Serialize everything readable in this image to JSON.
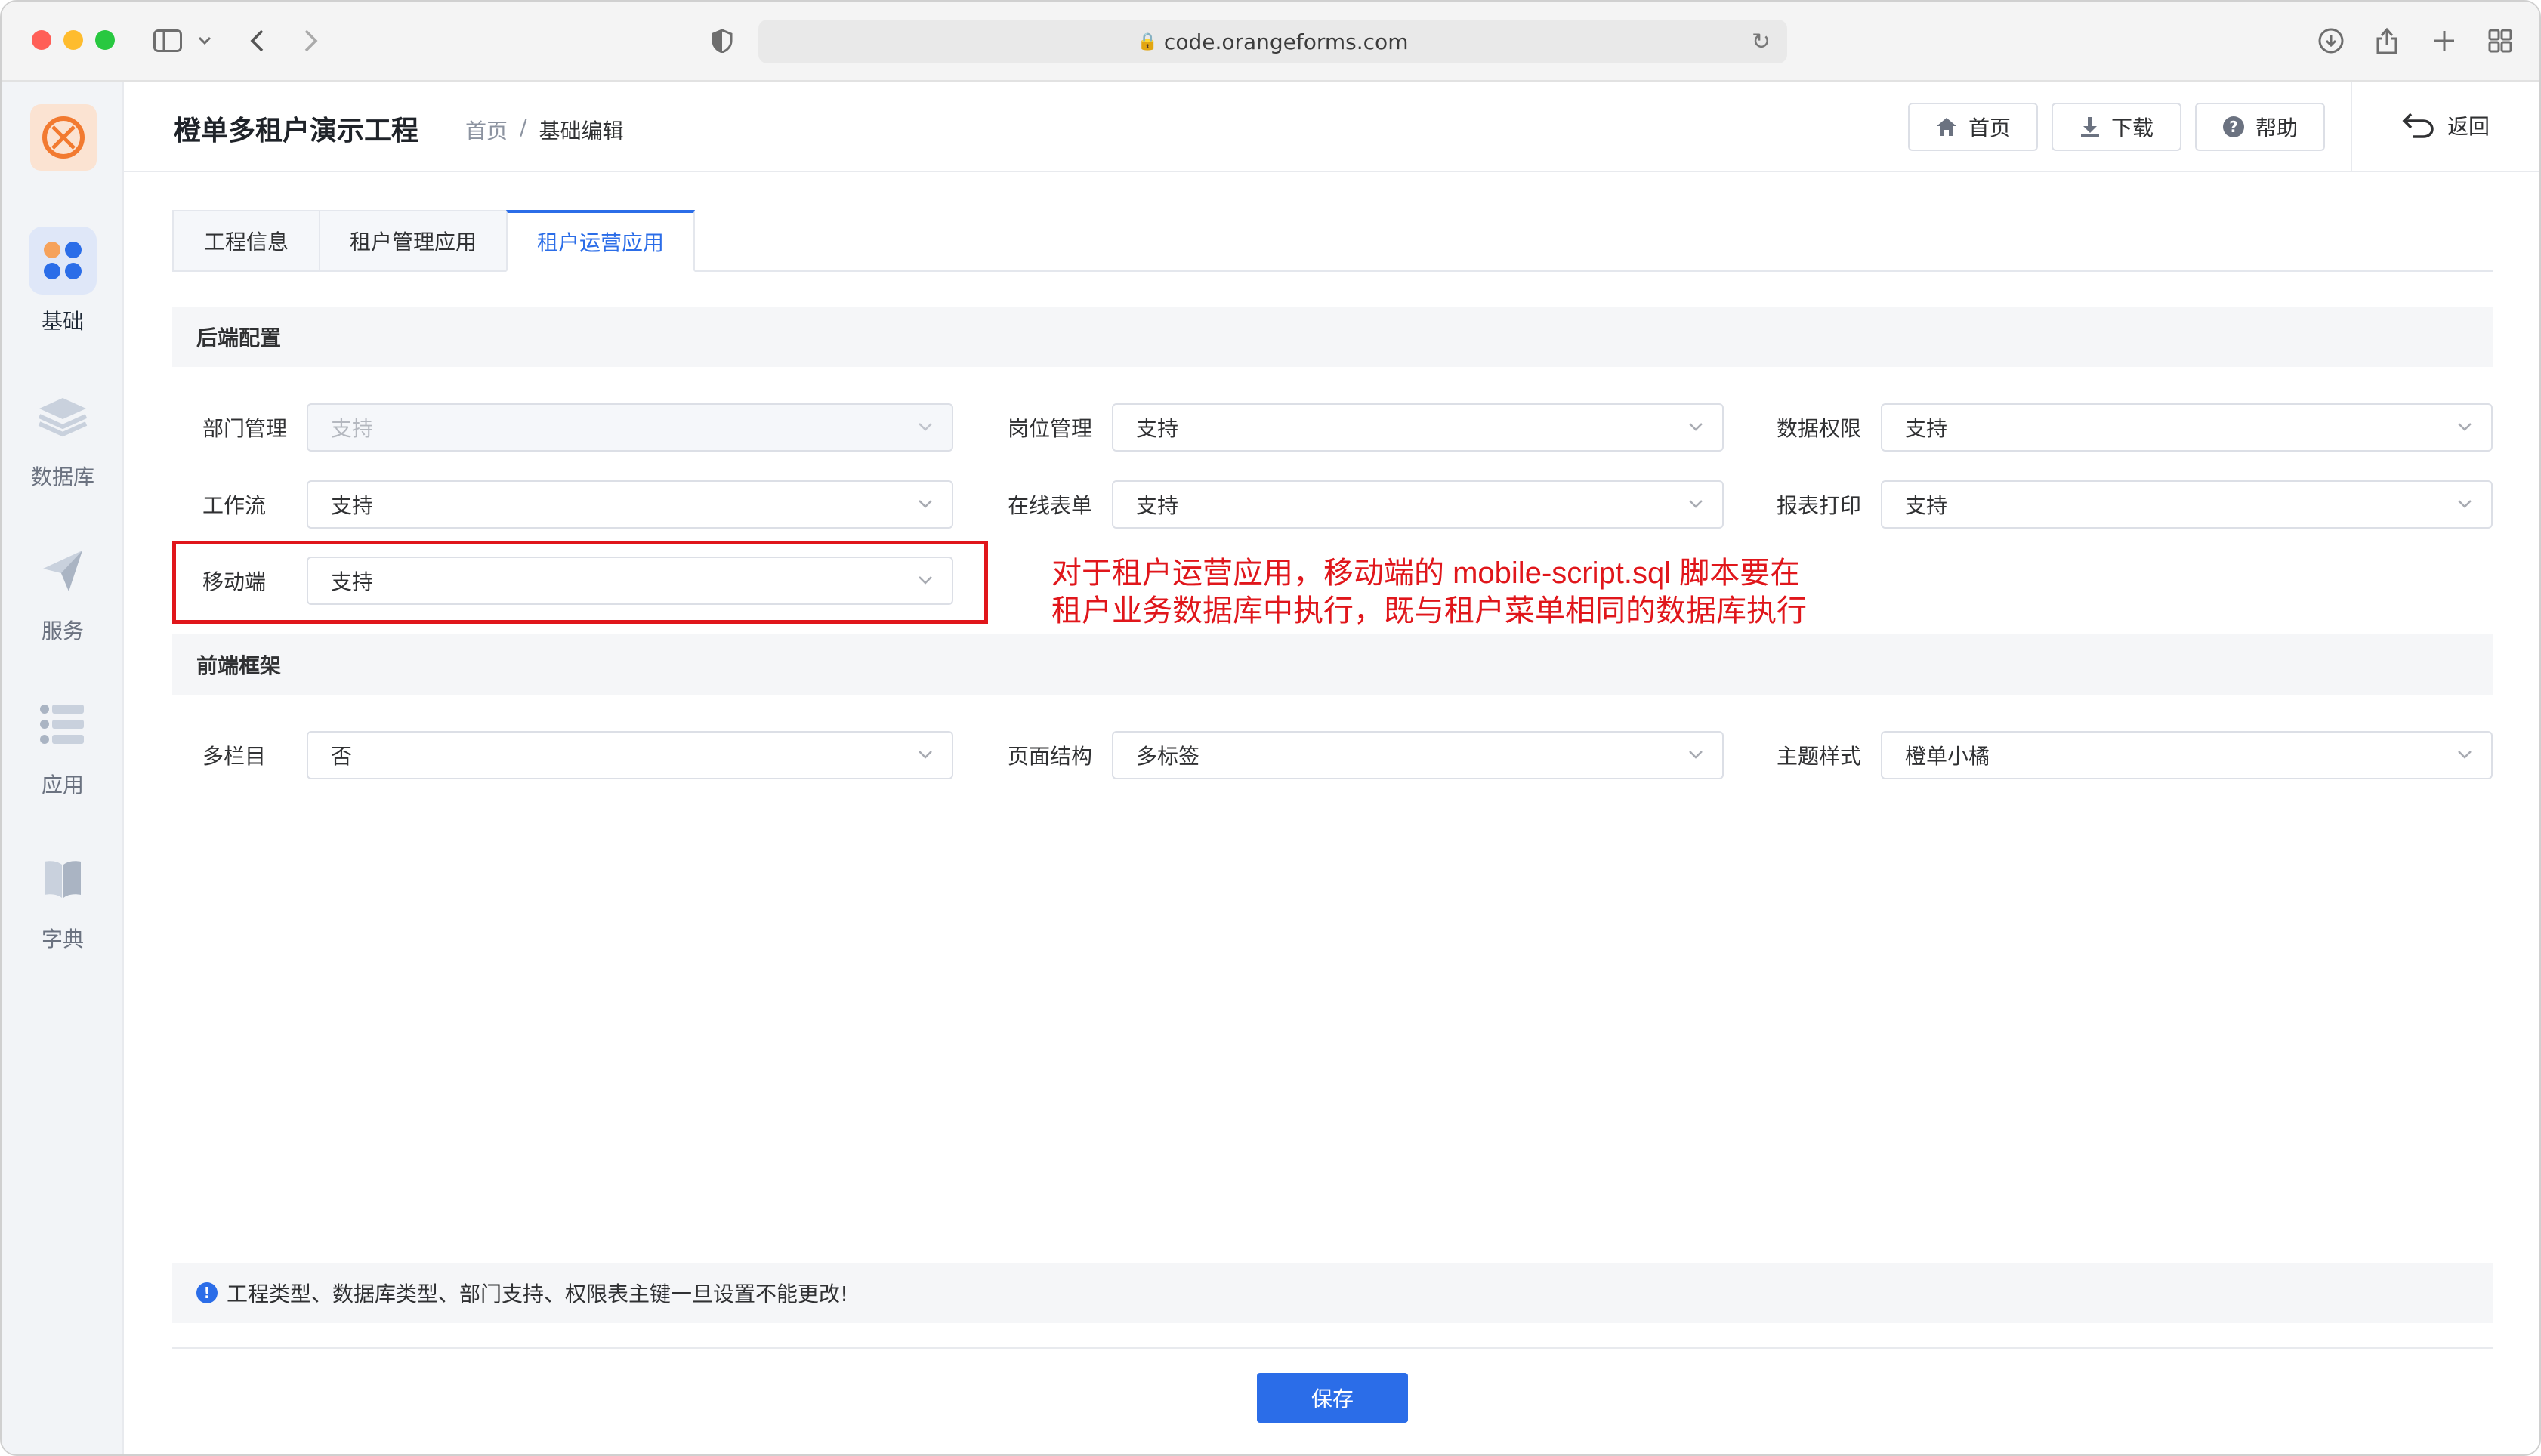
{
  "browser": {
    "url": "code.orangeforms.com"
  },
  "sidebar": {
    "items": [
      {
        "label": "基础",
        "icon": "grid-apps-icon",
        "active": true
      },
      {
        "label": "数据库",
        "icon": "layers-icon",
        "active": false
      },
      {
        "label": "服务",
        "icon": "send-icon",
        "active": false
      },
      {
        "label": "应用",
        "icon": "list-icon",
        "active": false
      },
      {
        "label": "字典",
        "icon": "book-icon",
        "active": false
      }
    ]
  },
  "header": {
    "title": "橙单多租户演示工程",
    "breadcrumb": [
      "首页",
      "/",
      "基础编辑"
    ],
    "buttons": {
      "home": "首页",
      "download": "下载",
      "help": "帮助"
    },
    "back": "返回"
  },
  "tabs": [
    {
      "label": "工程信息",
      "active": false
    },
    {
      "label": "租户管理应用",
      "active": false
    },
    {
      "label": "租户运营应用",
      "active": true
    }
  ],
  "backend": {
    "title": "后端配置",
    "fields": {
      "dept": {
        "label": "部门管理",
        "value": "支持",
        "disabled": true
      },
      "post": {
        "label": "岗位管理",
        "value": "支持"
      },
      "data_perm": {
        "label": "数据权限",
        "value": "支持"
      },
      "workflow": {
        "label": "工作流",
        "value": "支持"
      },
      "online_form": {
        "label": "在线表单",
        "value": "支持"
      },
      "report_print": {
        "label": "报表打印",
        "value": "支持"
      },
      "mobile": {
        "label": "移动端",
        "value": "支持"
      }
    }
  },
  "annotation": {
    "line1": "对于租户运营应用，移动端的 mobile-script.sql 脚本要在",
    "line2": "租户业务数据库中执行，既与租户菜单相同的数据库执行",
    "color": "#e0161b"
  },
  "frontend": {
    "title": "前端框架",
    "fields": {
      "multi_column": {
        "label": "多栏目",
        "value": "否"
      },
      "page_structure": {
        "label": "页面结构",
        "value": "多标签"
      },
      "theme": {
        "label": "主题样式",
        "value": "橙单小橘"
      }
    }
  },
  "notice": {
    "icon": "!",
    "text": "工程类型、数据库类型、部门支持、权限表主键一旦设置不能更改!"
  },
  "save_button": "保存",
  "colors": {
    "primary": "#2b6de8",
    "brand_orange": "#f27a30"
  }
}
